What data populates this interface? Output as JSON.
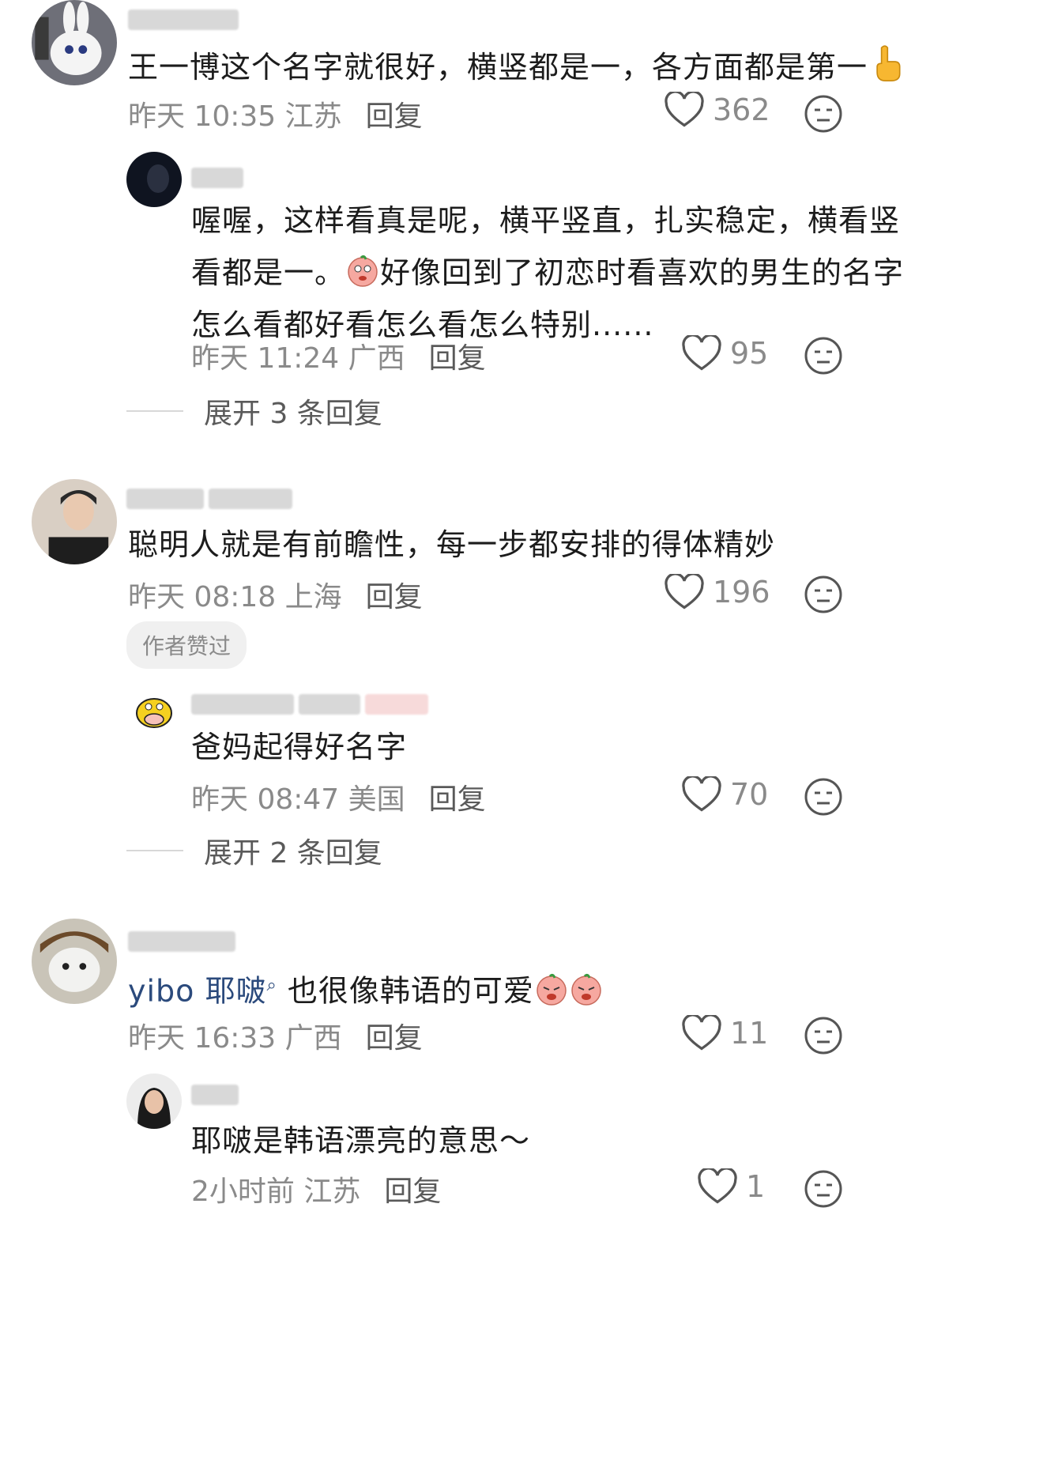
{
  "comments": [
    {
      "text": "王一博这个名字就很好，横竖都是一，各方面都是第一",
      "emoji": "pointing-up-emoji",
      "time": "昨天 10:35",
      "location": "江苏",
      "reply_label": "回复",
      "likes": "362"
    },
    {
      "text_line1": "喔喔，这样看真是呢，横平竖直，扎实稳定，横看竖",
      "text_line2a": "看都是一。",
      "text_line2b": "好像回到了初恋时看喜欢的男生的名字",
      "text_line3": "怎么看都好看怎么看怎么特别......",
      "time": "昨天 11:24",
      "location": "广西",
      "reply_label": "回复",
      "likes": "95"
    },
    {
      "expand_label": "展开 3 条回复"
    },
    {
      "text": "聪明人就是有前瞻性，每一步都安排的得体精妙",
      "time": "昨天 08:18",
      "location": "上海",
      "reply_label": "回复",
      "likes": "196",
      "author_tag": "作者赞过"
    },
    {
      "text": "爸妈起得好名字",
      "time": "昨天 08:47",
      "location": "美国",
      "reply_label": "回复",
      "likes": "70"
    },
    {
      "expand_label": "展开 2 条回复"
    },
    {
      "mention": "yibo 耶啵",
      "text": " 也很像韩语的可爱",
      "time": "昨天 16:33",
      "location": "广西",
      "reply_label": "回复",
      "likes": "11"
    },
    {
      "text": "耶啵是韩语漂亮的意思～",
      "time": "2小时前",
      "location": "江苏",
      "reply_label": "回复",
      "likes": "1"
    }
  ]
}
